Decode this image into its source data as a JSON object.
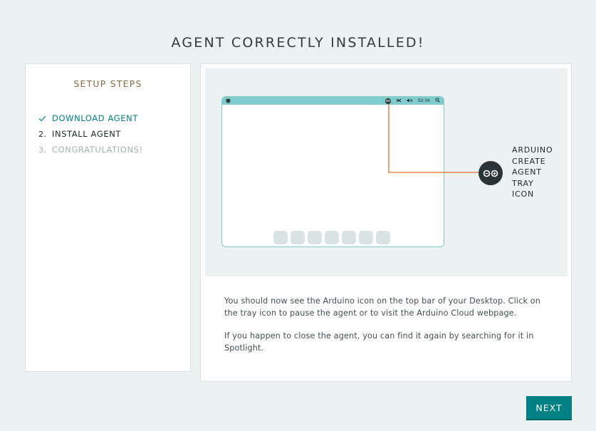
{
  "header": {
    "title": "AGENT CORRECTLY INSTALLED!"
  },
  "sidebar": {
    "title": "SETUP STEPS",
    "steps": [
      {
        "marker": "✓",
        "label": "DOWNLOAD AGENT",
        "state": "done"
      },
      {
        "marker": "2.",
        "label": "INSTALL AGENT",
        "state": "current"
      },
      {
        "marker": "3.",
        "label": "CONGRATULATIONS!",
        "state": "pending"
      }
    ]
  },
  "illustration": {
    "menubar_time": "02:34",
    "tray_label_lines": [
      "ARDUINO",
      "CREATE",
      "AGENT",
      "TRAY",
      "ICON"
    ],
    "dock_app_count": 7,
    "colors": {
      "screen_border": "#7fcbcd",
      "connector_line": "#e47128",
      "icon_bg": "#2a3335"
    }
  },
  "instructions": {
    "paragraph_1": "You should now see the Arduino icon on the top bar of your Desktop. Click on the tray icon to pause the agent or to visit the Arduino Cloud webpage.",
    "paragraph_2": "If you happen to close the agent, you can find it again by searching for it in Spotlight."
  },
  "footer": {
    "next_label": "NEXT"
  },
  "theme": {
    "accent": "#008184",
    "sidebar_title_color": "#8c6a45",
    "background": "#ecf1f1"
  }
}
